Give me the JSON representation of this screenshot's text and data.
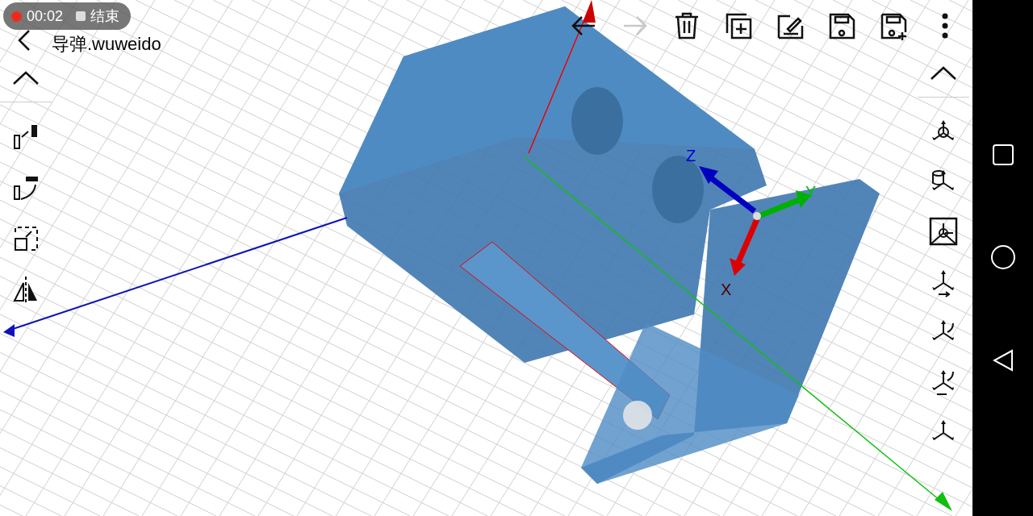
{
  "recording": {
    "time": "00:02",
    "stop_label": "结束"
  },
  "title": "导弹.wuweido",
  "top_toolbar": [
    {
      "kind": "undo",
      "disabled": false
    },
    {
      "kind": "redo",
      "disabled": true
    },
    {
      "kind": "delete",
      "disabled": false
    },
    {
      "kind": "add",
      "disabled": false
    },
    {
      "kind": "edit",
      "disabled": false
    },
    {
      "kind": "save",
      "disabled": false
    },
    {
      "kind": "save_as",
      "disabled": false
    },
    {
      "kind": "more",
      "disabled": false
    }
  ],
  "left_tools": [
    {
      "kind": "collapse"
    },
    {
      "kind": "move"
    },
    {
      "kind": "rotate"
    },
    {
      "kind": "scale"
    },
    {
      "kind": "mirror"
    }
  ],
  "right_tools": [
    {
      "kind": "collapse"
    },
    {
      "kind": "view_iso"
    },
    {
      "kind": "view_cylinder"
    },
    {
      "kind": "view_image"
    },
    {
      "kind": "view_front"
    },
    {
      "kind": "view_rotate"
    },
    {
      "kind": "view_rotate_move"
    },
    {
      "kind": "view_axes"
    }
  ],
  "gizmo_labels": {
    "z": "Z",
    "y": "Y",
    "x": "X"
  },
  "nav_bar": [
    {
      "kind": "recents"
    },
    {
      "kind": "home"
    },
    {
      "kind": "back"
    }
  ]
}
